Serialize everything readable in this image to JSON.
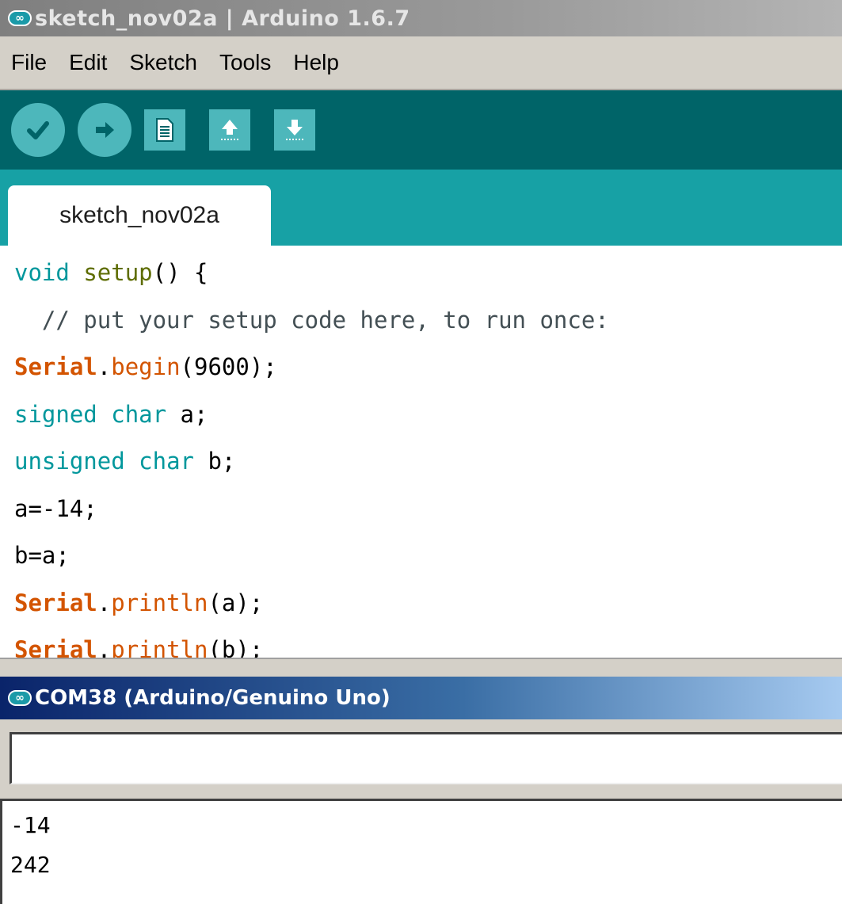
{
  "window": {
    "title": "sketch_nov02a | Arduino 1.6.7",
    "logo_glyph": "∞"
  },
  "menu": [
    "File",
    "Edit",
    "Sketch",
    "Tools",
    "Help"
  ],
  "toolbar": {
    "buttons": [
      "verify-icon",
      "upload-icon",
      "new-icon",
      "open-icon",
      "save-icon"
    ],
    "colors": {
      "bar": "#006468",
      "button": "#4db7bb",
      "tabstrip": "#17a1a5"
    }
  },
  "tabs": [
    {
      "label": "sketch_nov02a"
    }
  ],
  "editor": {
    "lines": [
      [
        {
          "t": "void",
          "c": "kw"
        },
        {
          "t": " ",
          "c": ""
        },
        {
          "t": "setup",
          "c": "fn"
        },
        {
          "t": "() {",
          "c": ""
        }
      ],
      [
        {
          "t": "  // put your setup code here, to run once:",
          "c": "cm"
        }
      ],
      [
        {
          "t": "Serial",
          "c": "cls"
        },
        {
          "t": ".",
          "c": ""
        },
        {
          "t": "begin",
          "c": "mth"
        },
        {
          "t": "(9600);",
          "c": ""
        }
      ],
      [
        {
          "t": "signed",
          "c": "kw"
        },
        {
          "t": " ",
          "c": ""
        },
        {
          "t": "char",
          "c": "kw"
        },
        {
          "t": " a;",
          "c": ""
        }
      ],
      [
        {
          "t": "unsigned",
          "c": "kw"
        },
        {
          "t": " ",
          "c": ""
        },
        {
          "t": "char",
          "c": "kw"
        },
        {
          "t": " b;",
          "c": ""
        }
      ],
      [
        {
          "t": "a=-14;",
          "c": ""
        }
      ],
      [
        {
          "t": "b=a;",
          "c": ""
        }
      ],
      [
        {
          "t": "Serial",
          "c": "cls"
        },
        {
          "t": ".",
          "c": ""
        },
        {
          "t": "println",
          "c": "mth"
        },
        {
          "t": "(a);",
          "c": ""
        }
      ],
      [
        {
          "t": "Serial",
          "c": "cls"
        },
        {
          "t": ".",
          "c": ""
        },
        {
          "t": "println",
          "c": "mth"
        },
        {
          "t": "(b);",
          "c": ""
        }
      ],
      [
        {
          "t": "}",
          "c": ""
        }
      ]
    ]
  },
  "serial_monitor": {
    "title": "COM38 (Arduino/Genuino Uno)",
    "input_value": "",
    "output_lines": [
      "-14",
      "242"
    ]
  }
}
